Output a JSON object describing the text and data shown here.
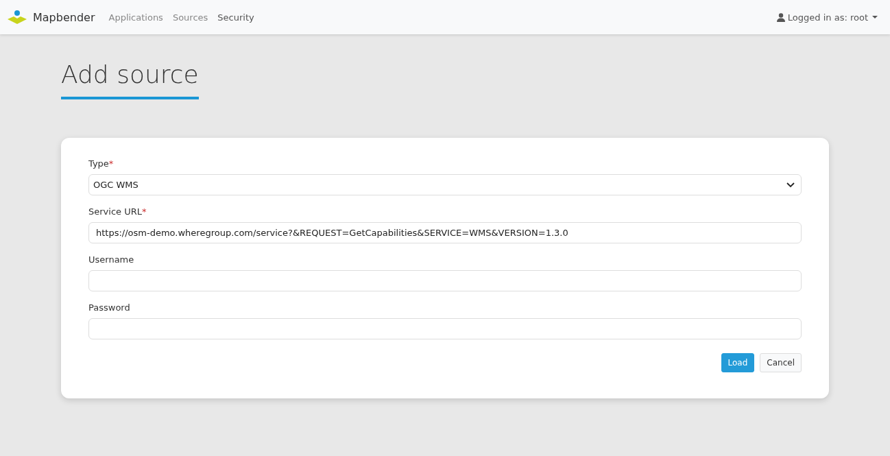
{
  "navbar": {
    "brand": "Mapbender",
    "links": [
      {
        "label": "Applications",
        "selected": false
      },
      {
        "label": "Sources",
        "selected": false
      },
      {
        "label": "Security",
        "selected": true
      }
    ],
    "user_menu": "Logged in as: root"
  },
  "page_title": "Add source",
  "form": {
    "fields": [
      {
        "kind": "select",
        "label": "Type",
        "required_mark": "*",
        "value": "OGC WMS"
      },
      {
        "kind": "text",
        "label": "Service URL",
        "required_mark": "*",
        "value": "https://osm-demo.wheregroup.com/service?&REQUEST=GetCapabilities&SERVICE=WMS&VERSION=1.3.0"
      },
      {
        "kind": "text",
        "label": "Username"
      },
      {
        "kind": "password",
        "label": "Password"
      }
    ],
    "buttons": [
      {
        "label": "Load",
        "kind": "primary"
      },
      {
        "label": "Cancel",
        "kind": "secondary"
      }
    ]
  }
}
